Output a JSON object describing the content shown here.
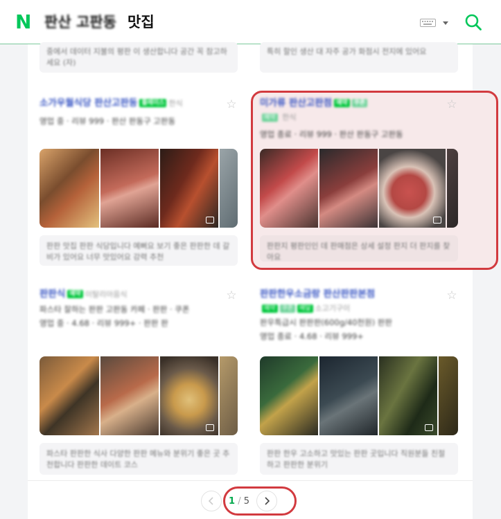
{
  "header": {
    "logo": "N",
    "query_main": "판산 고판동",
    "query_tail": "맛집",
    "keyboard_icon": "keyboard-icon",
    "search_icon": "search-icon",
    "brand_color": "#03c75a"
  },
  "top_reviews": [
    "중에서 데이터 지불의 평판 이 생산합니다 공간 꼭 참고하세요 (자)",
    "특히 할인 생산 대 자주 공가 화점시 전지에 있어요"
  ],
  "cards": [
    {
      "title": "소가우월식당 판산고판동",
      "tags": [
        "플레이스"
      ],
      "category": "한식",
      "meta": "영업 중 · 리뷰 999 · 판산 판동구 고판동",
      "review": "판판 맛집 판판 식당입니다 예뻐요 보기 좋은 판판한 데 갈비가 있어요 너무 맛있어요 강력 추천"
    },
    {
      "title": "미가류 판산고판점",
      "tags": [
        "예약",
        "쿠폰"
      ],
      "category": "한식",
      "meta": "영업 종료 · 리뷰 999 · 판산 판동구 고판동",
      "review": "판판지 평판인인 데 판매점은 상세 설정 판지 더 판지를 찾아요"
    },
    {
      "title": "판판식",
      "tags": [
        "예약"
      ],
      "category": "이탈리아음식",
      "meta": "파스타 잘하는 판판 고판동 카페 · 판판 · 쿠폰",
      "meta2": "영업 중 · 4.68 · 리뷰 999+ · 판판 판",
      "review": "파스타 판판한 식사 다양한 판판 메뉴와 분위기 좋은 곳 추천합니다 판판한 데이트 코스"
    },
    {
      "title": "판판한우소금랑 판산판판본점",
      "tags": [
        "예약",
        "쿠폰",
        "배달"
      ],
      "category": "소고기구이",
      "meta": "판우특급시 판판판(600g/40천원) 판판",
      "meta2": "영업 종료 · 4.68 · 리뷰 999+",
      "review": "판판 한우 고소하고 맛있는 판판 곳입니다 직원분들 친절하고 판판한 분위기"
    }
  ],
  "pagination": {
    "current": "1",
    "separator": "/",
    "total": "5",
    "prev_icon": "chevron-left-icon",
    "next_icon": "chevron-right-icon"
  },
  "highlight_color": "#d23a3f"
}
